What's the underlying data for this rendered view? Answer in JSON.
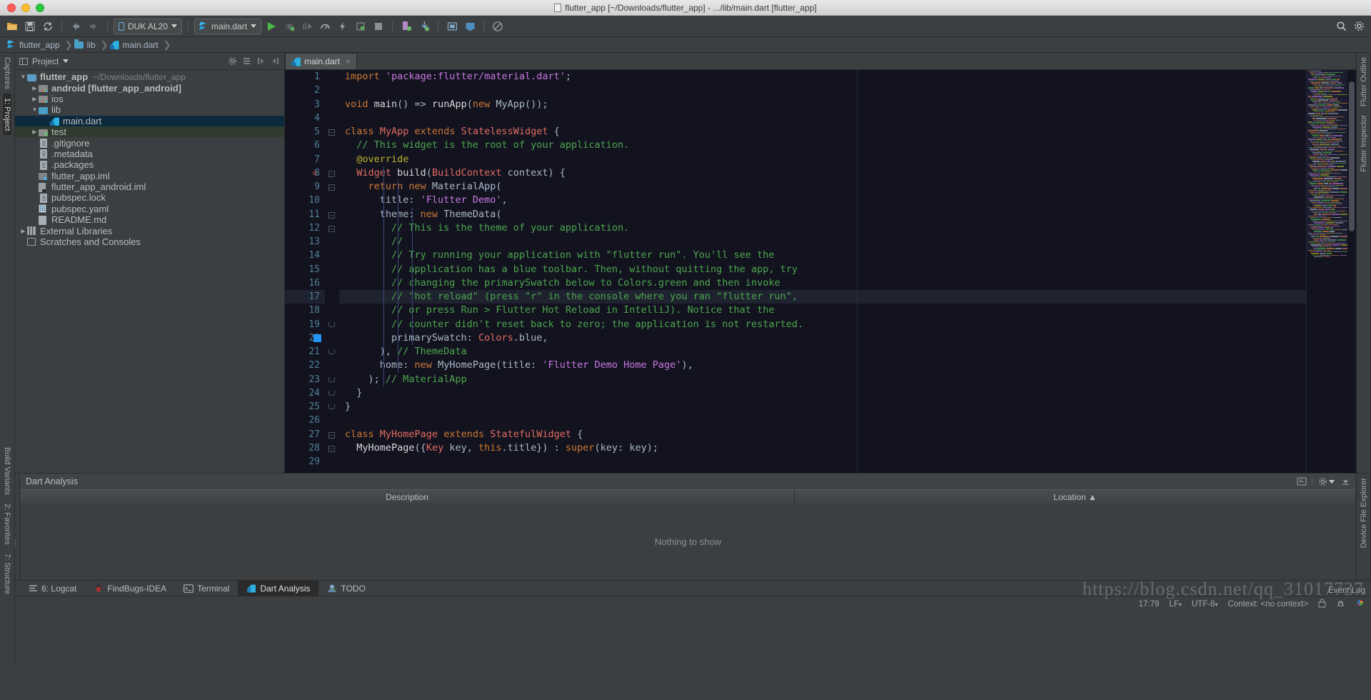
{
  "window": {
    "title": "flutter_app [~/Downloads/flutter_app] - .../lib/main.dart [flutter_app]"
  },
  "toolbar": {
    "device_selector": "DUK AL20",
    "run_config": "main.dart",
    "icons": [
      "open-folder-icon",
      "save-icon",
      "sync-icon",
      "back-icon",
      "forward-icon",
      "run-icon",
      "debug-icon",
      "run-coverage-icon",
      "profile-icon",
      "hot-reload-icon",
      "attach-debugger-icon",
      "stop-icon",
      "avd-manager-icon",
      "sdk-manager-icon",
      "layout-inspector-icon",
      "device-monitor-icon",
      "search-everywhere-icon",
      "settings-icon"
    ]
  },
  "breadcrumb": {
    "items": [
      {
        "label": "flutter_app",
        "icon": "flutter-icon"
      },
      {
        "label": "lib",
        "icon": "folder-icon"
      },
      {
        "label": "main.dart",
        "icon": "dart-file-icon"
      }
    ]
  },
  "left_strip": {
    "items": [
      "Captures",
      "1: Project"
    ],
    "bottom_items": [
      "Build Variants",
      "2: Favorites",
      "7: Structure"
    ]
  },
  "right_strip": {
    "items": [
      "Flutter Outline",
      "Flutter Inspector"
    ]
  },
  "project_panel": {
    "title": "Project",
    "tree": [
      {
        "indent": 0,
        "arrow": "down",
        "icon": "project-folder-icon",
        "label": "flutter_app",
        "bold": true,
        "path": "~/Downloads/flutter_app",
        "state": "normal"
      },
      {
        "indent": 1,
        "arrow": "right",
        "icon": "module-folder-icon",
        "label": "android [flutter_app_android]",
        "bold": true,
        "path": "",
        "state": "normal"
      },
      {
        "indent": 1,
        "arrow": "right",
        "icon": "module-folder-icon",
        "label": "ios",
        "bold": false,
        "path": "",
        "state": "normal"
      },
      {
        "indent": 1,
        "arrow": "down",
        "icon": "source-folder-icon",
        "label": "lib",
        "bold": false,
        "path": "",
        "state": "normal"
      },
      {
        "indent": 2,
        "arrow": "none",
        "icon": "dart-file-icon",
        "label": "main.dart",
        "bold": false,
        "path": "",
        "state": "selected"
      },
      {
        "indent": 1,
        "arrow": "right",
        "icon": "test-folder-icon",
        "label": "test",
        "bold": false,
        "path": "",
        "state": "test"
      },
      {
        "indent": 1,
        "arrow": "none",
        "icon": "file-icon",
        "label": ".gitignore",
        "bold": false,
        "path": "",
        "state": "normal"
      },
      {
        "indent": 1,
        "arrow": "none",
        "icon": "file-icon",
        "label": ".metadata",
        "bold": false,
        "path": "",
        "state": "normal"
      },
      {
        "indent": 1,
        "arrow": "none",
        "icon": "file-icon",
        "label": ".packages",
        "bold": false,
        "path": "",
        "state": "normal"
      },
      {
        "indent": 1,
        "arrow": "none",
        "icon": "iml-icon",
        "label": "flutter_app.iml",
        "bold": false,
        "path": "",
        "state": "normal"
      },
      {
        "indent": 1,
        "arrow": "none",
        "icon": "iml-android-icon",
        "label": "flutter_app_android.iml",
        "bold": false,
        "path": "",
        "state": "normal"
      },
      {
        "indent": 1,
        "arrow": "none",
        "icon": "file-icon",
        "label": "pubspec.lock",
        "bold": false,
        "path": "",
        "state": "normal"
      },
      {
        "indent": 1,
        "arrow": "none",
        "icon": "yaml-icon",
        "label": "pubspec.yaml",
        "bold": false,
        "path": "",
        "state": "normal"
      },
      {
        "indent": 1,
        "arrow": "none",
        "icon": "markdown-icon",
        "label": "README.md",
        "bold": false,
        "path": "",
        "state": "normal"
      },
      {
        "indent": 0,
        "arrow": "right",
        "icon": "libraries-icon",
        "label": "External Libraries",
        "bold": false,
        "path": "",
        "state": "normal"
      },
      {
        "indent": 0,
        "arrow": "none",
        "icon": "scratches-icon",
        "label": "Scratches and Consoles",
        "bold": false,
        "path": "",
        "state": "normal"
      }
    ]
  },
  "editor": {
    "tab": {
      "label": "main.dart",
      "icon": "dart-file-icon",
      "close": "×"
    },
    "current_line": 17,
    "lines": [
      {
        "n": 1,
        "tokens": [
          {
            "t": "import ",
            "c": "kw"
          },
          {
            "t": "'package:flutter/material.dart'",
            "c": "str"
          },
          {
            "t": ";",
            "c": "plain"
          }
        ]
      },
      {
        "n": 2,
        "tokens": []
      },
      {
        "n": 3,
        "tokens": [
          {
            "t": "void ",
            "c": "kw"
          },
          {
            "t": "main",
            "c": "fn"
          },
          {
            "t": "() => ",
            "c": "plain"
          },
          {
            "t": "runApp",
            "c": "fn"
          },
          {
            "t": "(",
            "c": "plain"
          },
          {
            "t": "new ",
            "c": "kw"
          },
          {
            "t": "MyApp",
            "c": "plain"
          },
          {
            "t": "());",
            "c": "plain"
          }
        ]
      },
      {
        "n": 4,
        "tokens": []
      },
      {
        "n": 5,
        "tokens": [
          {
            "t": "class ",
            "c": "kw"
          },
          {
            "t": "MyApp",
            "c": "cls"
          },
          {
            "t": " extends ",
            "c": "kw"
          },
          {
            "t": "StatelessWidget",
            "c": "cls"
          },
          {
            "t": " {",
            "c": "plain"
          }
        ]
      },
      {
        "n": 6,
        "tokens": [
          {
            "t": "  // This widget is the root of your application.",
            "c": "cmt"
          }
        ]
      },
      {
        "n": 7,
        "tokens": [
          {
            "t": "  @override",
            "c": "ann"
          }
        ]
      },
      {
        "n": 8,
        "tokens": [
          {
            "t": "  Widget",
            "c": "cls"
          },
          {
            "t": " build",
            "c": "fn"
          },
          {
            "t": "(",
            "c": "plain"
          },
          {
            "t": "BuildContext",
            "c": "cls"
          },
          {
            "t": " context) {",
            "c": "plain"
          }
        ]
      },
      {
        "n": 9,
        "tokens": [
          {
            "t": "    return ",
            "c": "kw"
          },
          {
            "t": "new ",
            "c": "kw"
          },
          {
            "t": "MaterialApp",
            "c": "plain"
          },
          {
            "t": "(",
            "c": "plain"
          }
        ]
      },
      {
        "n": 10,
        "tokens": [
          {
            "t": "      title: ",
            "c": "plain"
          },
          {
            "t": "'Flutter Demo'",
            "c": "str"
          },
          {
            "t": ",",
            "c": "plain"
          }
        ]
      },
      {
        "n": 11,
        "tokens": [
          {
            "t": "      theme: ",
            "c": "plain"
          },
          {
            "t": "new ",
            "c": "kw"
          },
          {
            "t": "ThemeData",
            "c": "plain"
          },
          {
            "t": "(",
            "c": "plain"
          }
        ]
      },
      {
        "n": 12,
        "tokens": [
          {
            "t": "        // This is the theme of your application.",
            "c": "cmt"
          }
        ]
      },
      {
        "n": 13,
        "tokens": [
          {
            "t": "        //",
            "c": "cmt"
          }
        ]
      },
      {
        "n": 14,
        "tokens": [
          {
            "t": "        // Try running your application with \"flutter run\". You'll see the",
            "c": "cmt"
          }
        ]
      },
      {
        "n": 15,
        "tokens": [
          {
            "t": "        // application has a blue toolbar. Then, without quitting the app, try",
            "c": "cmt"
          }
        ]
      },
      {
        "n": 16,
        "tokens": [
          {
            "t": "        // changing the primarySwatch below to Colors.green and then invoke",
            "c": "cmt"
          }
        ]
      },
      {
        "n": 17,
        "tokens": [
          {
            "t": "        // \"hot reload\" (press \"r\" in the console where you ran \"flutter run\",",
            "c": "cmt"
          }
        ]
      },
      {
        "n": 18,
        "tokens": [
          {
            "t": "        // or press Run > Flutter Hot Reload in IntelliJ). Notice that the",
            "c": "cmt"
          }
        ]
      },
      {
        "n": 19,
        "tokens": [
          {
            "t": "        // counter didn't reset back to zero; the application is not restarted.",
            "c": "cmt"
          }
        ]
      },
      {
        "n": 20,
        "tokens": [
          {
            "t": "        primarySwatch: ",
            "c": "plain"
          },
          {
            "t": "Colors",
            "c": "cls"
          },
          {
            "t": ".blue,",
            "c": "plain"
          }
        ]
      },
      {
        "n": 21,
        "tokens": [
          {
            "t": "      ), ",
            "c": "plain"
          },
          {
            "t": "// ThemeData",
            "c": "cmt"
          }
        ]
      },
      {
        "n": 22,
        "tokens": [
          {
            "t": "      home: ",
            "c": "plain"
          },
          {
            "t": "new ",
            "c": "kw"
          },
          {
            "t": "MyHomePage",
            "c": "plain"
          },
          {
            "t": "(title: ",
            "c": "plain"
          },
          {
            "t": "'Flutter Demo Home Page'",
            "c": "str"
          },
          {
            "t": "),",
            "c": "plain"
          }
        ]
      },
      {
        "n": 23,
        "tokens": [
          {
            "t": "    ); ",
            "c": "plain"
          },
          {
            "t": "// MaterialApp",
            "c": "cmt"
          }
        ]
      },
      {
        "n": 24,
        "tokens": [
          {
            "t": "  }",
            "c": "plain"
          }
        ]
      },
      {
        "n": 25,
        "tokens": [
          {
            "t": "}",
            "c": "plain"
          }
        ]
      },
      {
        "n": 26,
        "tokens": []
      },
      {
        "n": 27,
        "tokens": [
          {
            "t": "class ",
            "c": "kw"
          },
          {
            "t": "MyHomePage",
            "c": "cls"
          },
          {
            "t": " extends ",
            "c": "kw"
          },
          {
            "t": "StatefulWidget",
            "c": "cls"
          },
          {
            "t": " {",
            "c": "plain"
          }
        ]
      },
      {
        "n": 28,
        "tokens": [
          {
            "t": "  MyHomePage",
            "c": "fn"
          },
          {
            "t": "({",
            "c": "plain"
          },
          {
            "t": "Key",
            "c": "cls"
          },
          {
            "t": " key, ",
            "c": "plain"
          },
          {
            "t": "this",
            "c": "kw"
          },
          {
            "t": ".title}) : ",
            "c": "plain"
          },
          {
            "t": "super",
            "c": "kw"
          },
          {
            "t": "(key: key);",
            "c": "plain"
          }
        ]
      },
      {
        "n": 29,
        "tokens": []
      }
    ],
    "color_swatch_line": 20,
    "color_swatch_hex": "#2196f3"
  },
  "analysis_panel": {
    "title": "Dart Analysis",
    "columns": [
      "Description",
      "Location ▲"
    ],
    "empty_message": "Nothing to show"
  },
  "bottom_tabs": [
    {
      "label": "6: Logcat",
      "icon": "logcat-icon",
      "active": false,
      "mnemonic": "6"
    },
    {
      "label": "FindBugs-IDEA",
      "icon": "findbugs-icon",
      "active": false,
      "mnemonic": ""
    },
    {
      "label": "Terminal",
      "icon": "terminal-icon",
      "active": false,
      "mnemonic": ""
    },
    {
      "label": "Dart Analysis",
      "icon": "dart-analysis-icon",
      "active": true,
      "mnemonic": ""
    },
    {
      "label": "TODO",
      "icon": "todo-icon",
      "active": false,
      "mnemonic": ""
    }
  ],
  "statusbar": {
    "caret_position": "17:79",
    "line_separator": "LF",
    "encoding": "UTF-8",
    "context": "Context: <no context>",
    "event_log": "Event Log"
  },
  "watermark": "https://blog.csdn.net/qq_31017737",
  "colors": {
    "editor_bg": "#131320",
    "panel_bg": "#3c3f41",
    "selection": "#0d293e",
    "comment": "#4ca64c",
    "keyword": "#cc7832",
    "string": "#c678dd",
    "class": "#e06c5f"
  }
}
